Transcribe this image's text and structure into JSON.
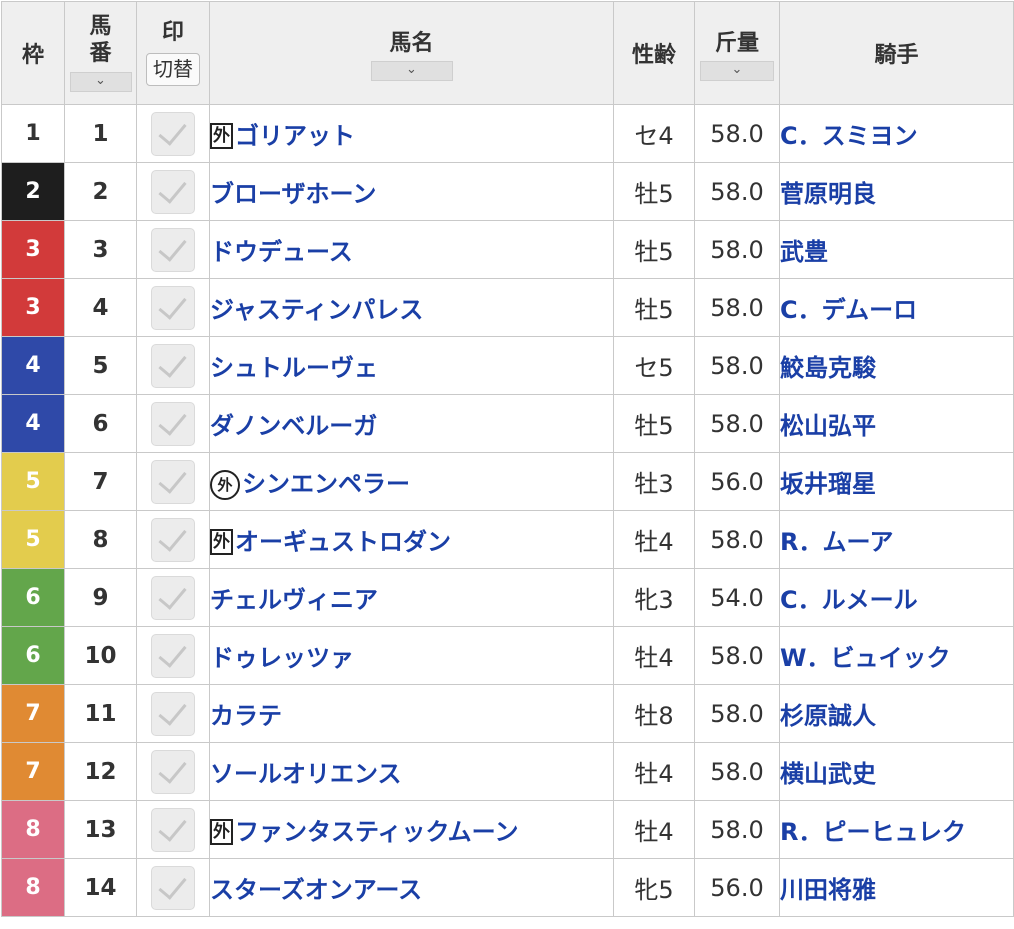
{
  "header": {
    "waku": "枠",
    "umaban": [
      "馬",
      "番"
    ],
    "mark": "印",
    "mark_toggle": "切替",
    "horse_name": "馬名",
    "sex_age": "性齢",
    "weight": "斤量",
    "jockey": "騎手",
    "sort_icon": "chevron-down-icon"
  },
  "colors": {
    "waku_1": "#ffffff",
    "waku_2": "#1e1e1e",
    "waku_3": "#d23a3a",
    "waku_4": "#2f49a8",
    "waku_5": "#e3cc4d",
    "waku_6": "#63a64b",
    "waku_7": "#e08a33",
    "waku_8": "#dc6d84",
    "link": "#1a3fa6"
  },
  "rows": [
    {
      "waku": "1",
      "umaban": "1",
      "badge": "外",
      "badge_type": "box",
      "name": "ゴリアット",
      "sex_age": "セ4",
      "weight": "58.0",
      "jockey": "C．スミヨン"
    },
    {
      "waku": "2",
      "umaban": "2",
      "badge": "",
      "badge_type": "",
      "name": "ブローザホーン",
      "sex_age": "牡5",
      "weight": "58.0",
      "jockey": "菅原明良"
    },
    {
      "waku": "3",
      "umaban": "3",
      "badge": "",
      "badge_type": "",
      "name": "ドウデュース",
      "sex_age": "牡5",
      "weight": "58.0",
      "jockey": "武豊"
    },
    {
      "waku": "3",
      "umaban": "4",
      "badge": "",
      "badge_type": "",
      "name": "ジャスティンパレス",
      "sex_age": "牡5",
      "weight": "58.0",
      "jockey": "C．デムーロ"
    },
    {
      "waku": "4",
      "umaban": "5",
      "badge": "",
      "badge_type": "",
      "name": "シュトルーヴェ",
      "sex_age": "セ5",
      "weight": "58.0",
      "jockey": "鮫島克駿"
    },
    {
      "waku": "4",
      "umaban": "6",
      "badge": "",
      "badge_type": "",
      "name": "ダノンベルーガ",
      "sex_age": "牡5",
      "weight": "58.0",
      "jockey": "松山弘平"
    },
    {
      "waku": "5",
      "umaban": "7",
      "badge": "外",
      "badge_type": "circle",
      "name": "シンエンペラー",
      "sex_age": "牡3",
      "weight": "56.0",
      "jockey": "坂井瑠星"
    },
    {
      "waku": "5",
      "umaban": "8",
      "badge": "外",
      "badge_type": "box",
      "name": "オーギュストロダン",
      "sex_age": "牡4",
      "weight": "58.0",
      "jockey": "R．ムーア"
    },
    {
      "waku": "6",
      "umaban": "9",
      "badge": "",
      "badge_type": "",
      "name": "チェルヴィニア",
      "sex_age": "牝3",
      "weight": "54.0",
      "jockey": "C．ルメール"
    },
    {
      "waku": "6",
      "umaban": "10",
      "badge": "",
      "badge_type": "",
      "name": "ドゥレッツァ",
      "sex_age": "牡4",
      "weight": "58.0",
      "jockey": "W．ビュイック"
    },
    {
      "waku": "7",
      "umaban": "11",
      "badge": "",
      "badge_type": "",
      "name": "カラテ",
      "sex_age": "牡8",
      "weight": "58.0",
      "jockey": "杉原誠人"
    },
    {
      "waku": "7",
      "umaban": "12",
      "badge": "",
      "badge_type": "",
      "name": "ソールオリエンス",
      "sex_age": "牡4",
      "weight": "58.0",
      "jockey": "横山武史"
    },
    {
      "waku": "8",
      "umaban": "13",
      "badge": "外",
      "badge_type": "box",
      "name": "ファンタスティックムーン",
      "sex_age": "牡4",
      "weight": "58.0",
      "jockey": "R．ピーヒュレク"
    },
    {
      "waku": "8",
      "umaban": "14",
      "badge": "",
      "badge_type": "",
      "name": "スターズオンアース",
      "sex_age": "牝5",
      "weight": "56.0",
      "jockey": "川田将雅"
    }
  ]
}
